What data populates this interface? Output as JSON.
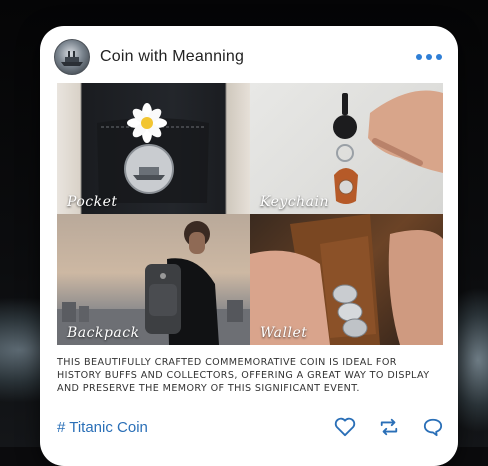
{
  "post": {
    "title": "Coin with Meanning",
    "avatar_icon": "ship-coin-avatar",
    "menu_icon": "more-dots-icon",
    "accent": "#2f7fd6"
  },
  "tiles": [
    {
      "label": "Pocket"
    },
    {
      "label": "Keychain"
    },
    {
      "label": "Backpack"
    },
    {
      "label": "Wallet"
    }
  ],
  "description": "THIS BEAUTIFULLY CRAFTED COMMEMORATIVE COIN IS IDEAL FOR HISTORY BUFFS AND COLLECTORS, OFFERING A GREAT WAY TO DISPLAY AND PRESERVE THE MEMORY OF THIS SIGNIFICANT EVENT.",
  "hashtag": "# Titanic Coin",
  "actions": [
    "heart-icon",
    "repost-icon",
    "comment-icon"
  ]
}
